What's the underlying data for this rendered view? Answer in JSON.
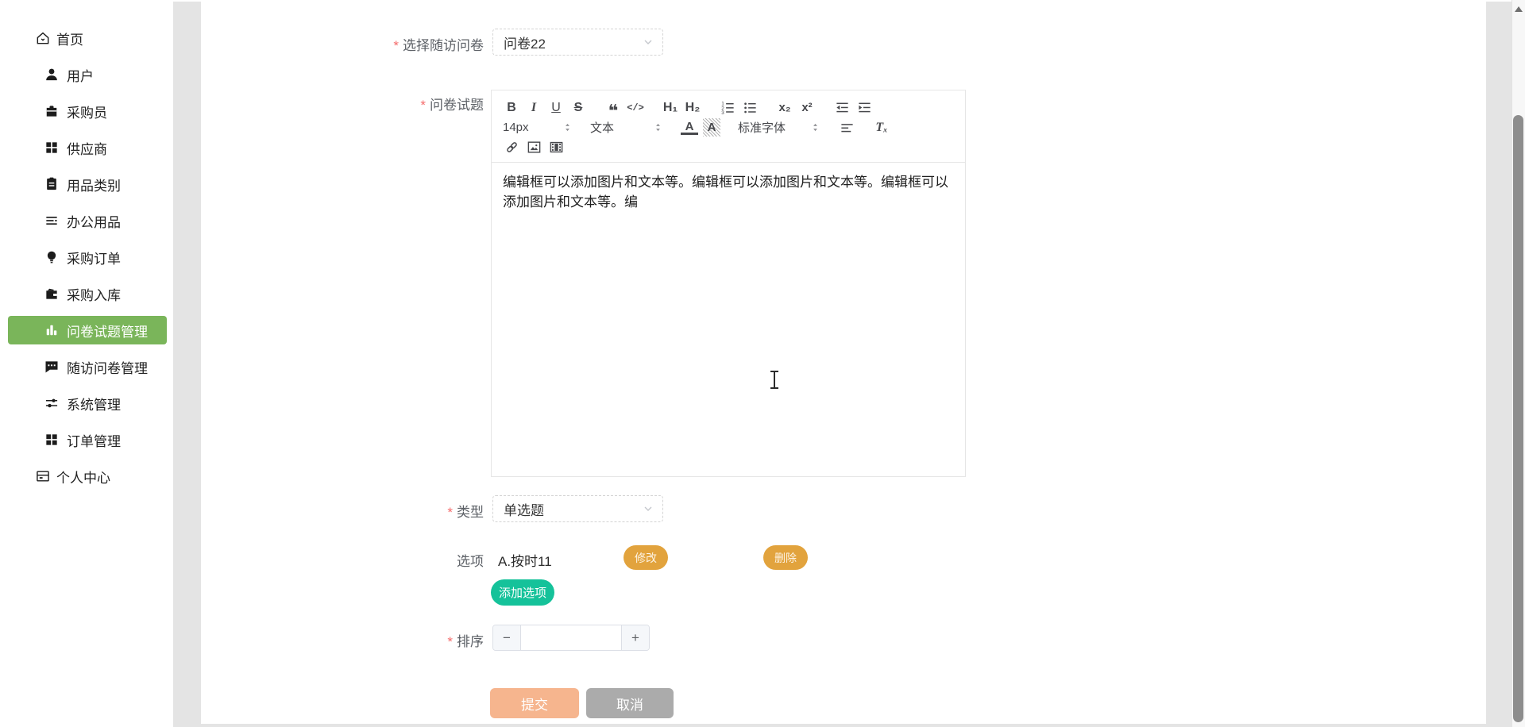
{
  "sidebar": {
    "items": [
      {
        "name": "home",
        "label": "首页",
        "icon": "home-icon",
        "active": false,
        "indent": false
      },
      {
        "name": "users",
        "label": "用户",
        "icon": "user-icon",
        "active": false,
        "indent": true
      },
      {
        "name": "purchaser",
        "label": "采购员",
        "icon": "briefcase-icon",
        "active": false,
        "indent": true
      },
      {
        "name": "supplier",
        "label": "供应商",
        "icon": "grid-icon",
        "active": false,
        "indent": true
      },
      {
        "name": "supply-category",
        "label": "用品类别",
        "icon": "clipboard-icon",
        "active": false,
        "indent": true
      },
      {
        "name": "office-supplies",
        "label": "办公用品",
        "icon": "list-lines-icon",
        "active": false,
        "indent": true
      },
      {
        "name": "purchase-order",
        "label": "采购订单",
        "icon": "lightbulb-icon",
        "active": false,
        "indent": true
      },
      {
        "name": "purchase-inbound",
        "label": "采购入库",
        "icon": "wallet-icon",
        "active": false,
        "indent": true
      },
      {
        "name": "question-management",
        "label": "问卷试题管理",
        "icon": "bar-chart-icon",
        "active": true,
        "indent": true
      },
      {
        "name": "followup-questionnaire",
        "label": "随访问卷管理",
        "icon": "chat-icon",
        "active": false,
        "indent": true
      },
      {
        "name": "system-management",
        "label": "系统管理",
        "icon": "sliders-icon",
        "active": false,
        "indent": true
      },
      {
        "name": "order-management",
        "label": "订单管理",
        "icon": "grid-icon",
        "active": false,
        "indent": true
      },
      {
        "name": "profile-center",
        "label": "个人中心",
        "icon": "card-icon",
        "active": false,
        "indent": false
      }
    ]
  },
  "form": {
    "required_mark": "*",
    "questionnaire_field": {
      "label": "选择随访问卷",
      "required": true,
      "value": "问卷22"
    },
    "question_field": {
      "label": "问卷试题",
      "required": true
    },
    "type_field": {
      "label": "类型",
      "required": true,
      "value": "单选题"
    },
    "options_field": {
      "label": "选项",
      "option_text": "A.按时11",
      "modify_label": "修改",
      "delete_label": "删除",
      "add_label": "添加选项"
    },
    "sort_field": {
      "label": "排序",
      "required": true,
      "value": "",
      "minus": "−",
      "plus": "+"
    },
    "submit_label": "提交",
    "cancel_label": "取消"
  },
  "editor": {
    "content": "编辑框可以添加图片和文本等。编辑框可以添加图片和文本等。编辑框可以添加图片和文本等。编",
    "toolbar": {
      "bold": "B",
      "italic": "I",
      "underline": "U",
      "strike": "S",
      "blockquote": "❝",
      "code": "</>",
      "h1": "H₁",
      "h2": "H₂",
      "subscript": "x₂",
      "superscript": "x²",
      "size_value": "14px",
      "style_value": "文本",
      "font_value": "标准字体",
      "color_letter": "A",
      "bg_letter": "A",
      "clean": "Tₓ"
    }
  },
  "icons": {
    "chevron-down-icon": "∨",
    "updown-arrows-icon": "⇅",
    "ordered-list-icon": "numbered list",
    "bullet-list-icon": "bullet list",
    "outdent-icon": "outdent",
    "indent-icon": "indent",
    "align-icon": "align",
    "link-icon": "link",
    "image-icon": "image",
    "video-icon": "video",
    "scroll-up-arrow-icon": "▲"
  },
  "colors": {
    "sidebar_active_bg": "#7ab55a",
    "pill_orange": "#e2a33d",
    "pill_green": "#15c29a",
    "submit_bg": "#f6b58e",
    "cancel_bg": "#ababab",
    "required_red": "#f56c6c"
  }
}
